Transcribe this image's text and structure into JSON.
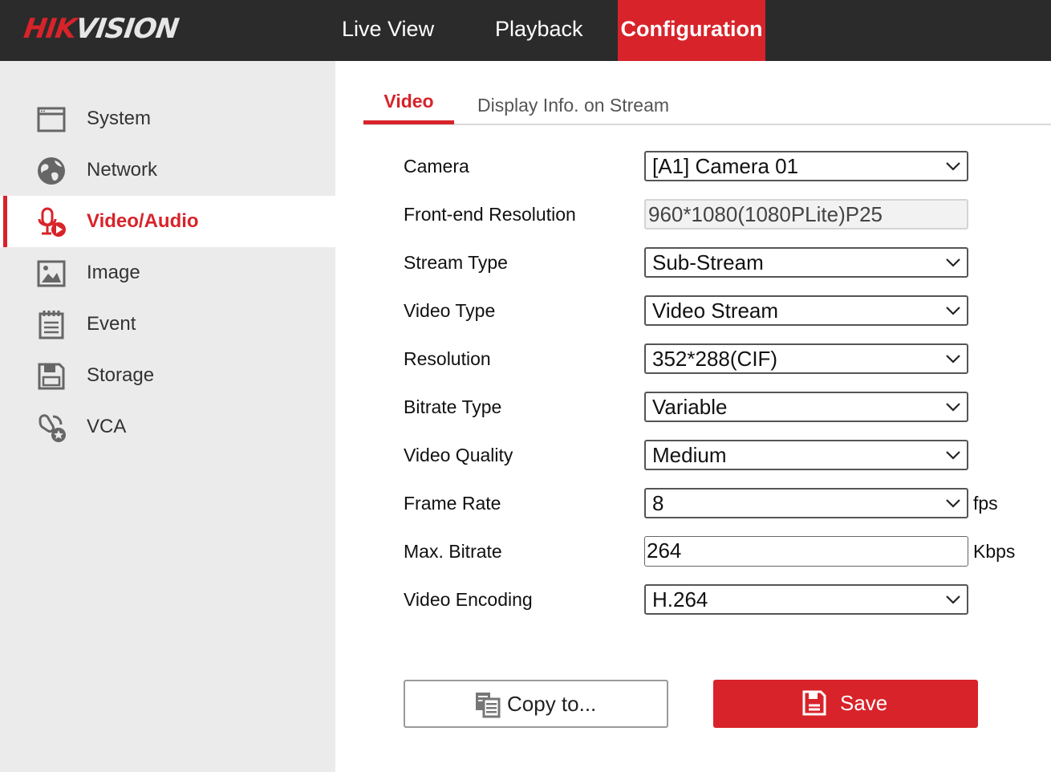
{
  "brand": {
    "logo_part1": "HIK",
    "logo_part2": "VISION",
    "accent_color": "#d8232a"
  },
  "topnav": {
    "items": [
      {
        "label": "Live View"
      },
      {
        "label": "Playback"
      },
      {
        "label": "Configuration",
        "active": true
      }
    ]
  },
  "sidebar": {
    "items": [
      {
        "label": "System",
        "icon": "window-icon"
      },
      {
        "label": "Network",
        "icon": "globe-icon"
      },
      {
        "label": "Video/Audio",
        "icon": "microphone-video-icon",
        "active": true
      },
      {
        "label": "Image",
        "icon": "image-icon"
      },
      {
        "label": "Event",
        "icon": "calendar-list-icon"
      },
      {
        "label": "Storage",
        "icon": "floppy-icon"
      },
      {
        "label": "VCA",
        "icon": "vca-icon"
      }
    ]
  },
  "tabs": [
    {
      "label": "Video",
      "active": true
    },
    {
      "label": "Display Info. on Stream"
    }
  ],
  "form": {
    "camera": {
      "label": "Camera",
      "value": "[A1] Camera 01"
    },
    "front_res": {
      "label": "Front-end Resolution",
      "value": "960*1080(1080PLite)P25"
    },
    "stream_type": {
      "label": "Stream Type",
      "value": "Sub-Stream"
    },
    "video_type": {
      "label": "Video Type",
      "value": "Video Stream"
    },
    "resolution": {
      "label": "Resolution",
      "value": "352*288(CIF)"
    },
    "bitrate_type": {
      "label": "Bitrate Type",
      "value": "Variable"
    },
    "video_quality": {
      "label": "Video Quality",
      "value": "Medium"
    },
    "frame_rate": {
      "label": "Frame Rate",
      "value": "8",
      "unit": "fps"
    },
    "max_bitrate": {
      "label": "Max. Bitrate",
      "value": "264",
      "unit": "Kbps"
    },
    "encoding": {
      "label": "Video Encoding",
      "value": "H.264"
    }
  },
  "buttons": {
    "copy_label": "Copy to...",
    "save_label": "Save"
  }
}
